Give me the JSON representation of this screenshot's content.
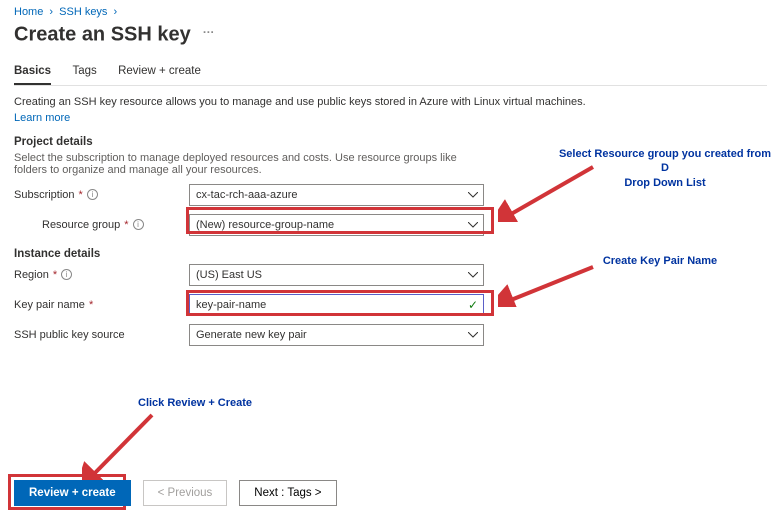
{
  "breadcrumb": {
    "home": "Home",
    "ssh": "SSH keys"
  },
  "title": "Create an SSH key",
  "ellipsis": "…",
  "tabs": {
    "basics": "Basics",
    "tags": "Tags",
    "review": "Review + create"
  },
  "intro": {
    "text": "Creating an SSH key resource allows you to manage and use public keys stored in Azure with Linux virtual machines.",
    "learn": "Learn more"
  },
  "project": {
    "heading": "Project details",
    "sub": "Select the subscription to manage deployed resources and costs. Use resource groups like folders to organize and manage all your resources.",
    "subscription_label": "Subscription",
    "subscription_value": "cx-tac-rch-aaa-azure",
    "rg_label": "Resource group",
    "rg_value": "(New) resource-group-name"
  },
  "instance": {
    "heading": "Instance details",
    "region_label": "Region",
    "region_value": "(US) East US",
    "keypair_label": "Key pair name",
    "keypair_value": "key-pair-name",
    "source_label": "SSH public key source",
    "source_value": "Generate new key pair"
  },
  "required": "*",
  "info_glyph": "i",
  "footer": {
    "review": "Review + create",
    "prev": "< Previous",
    "next": "Next : Tags >"
  },
  "anno": {
    "rg1": "Select Resource group you created from D",
    "rg2": "Drop Down List",
    "kp": "Create Key Pair Name",
    "rc": "Click Review + Create"
  }
}
